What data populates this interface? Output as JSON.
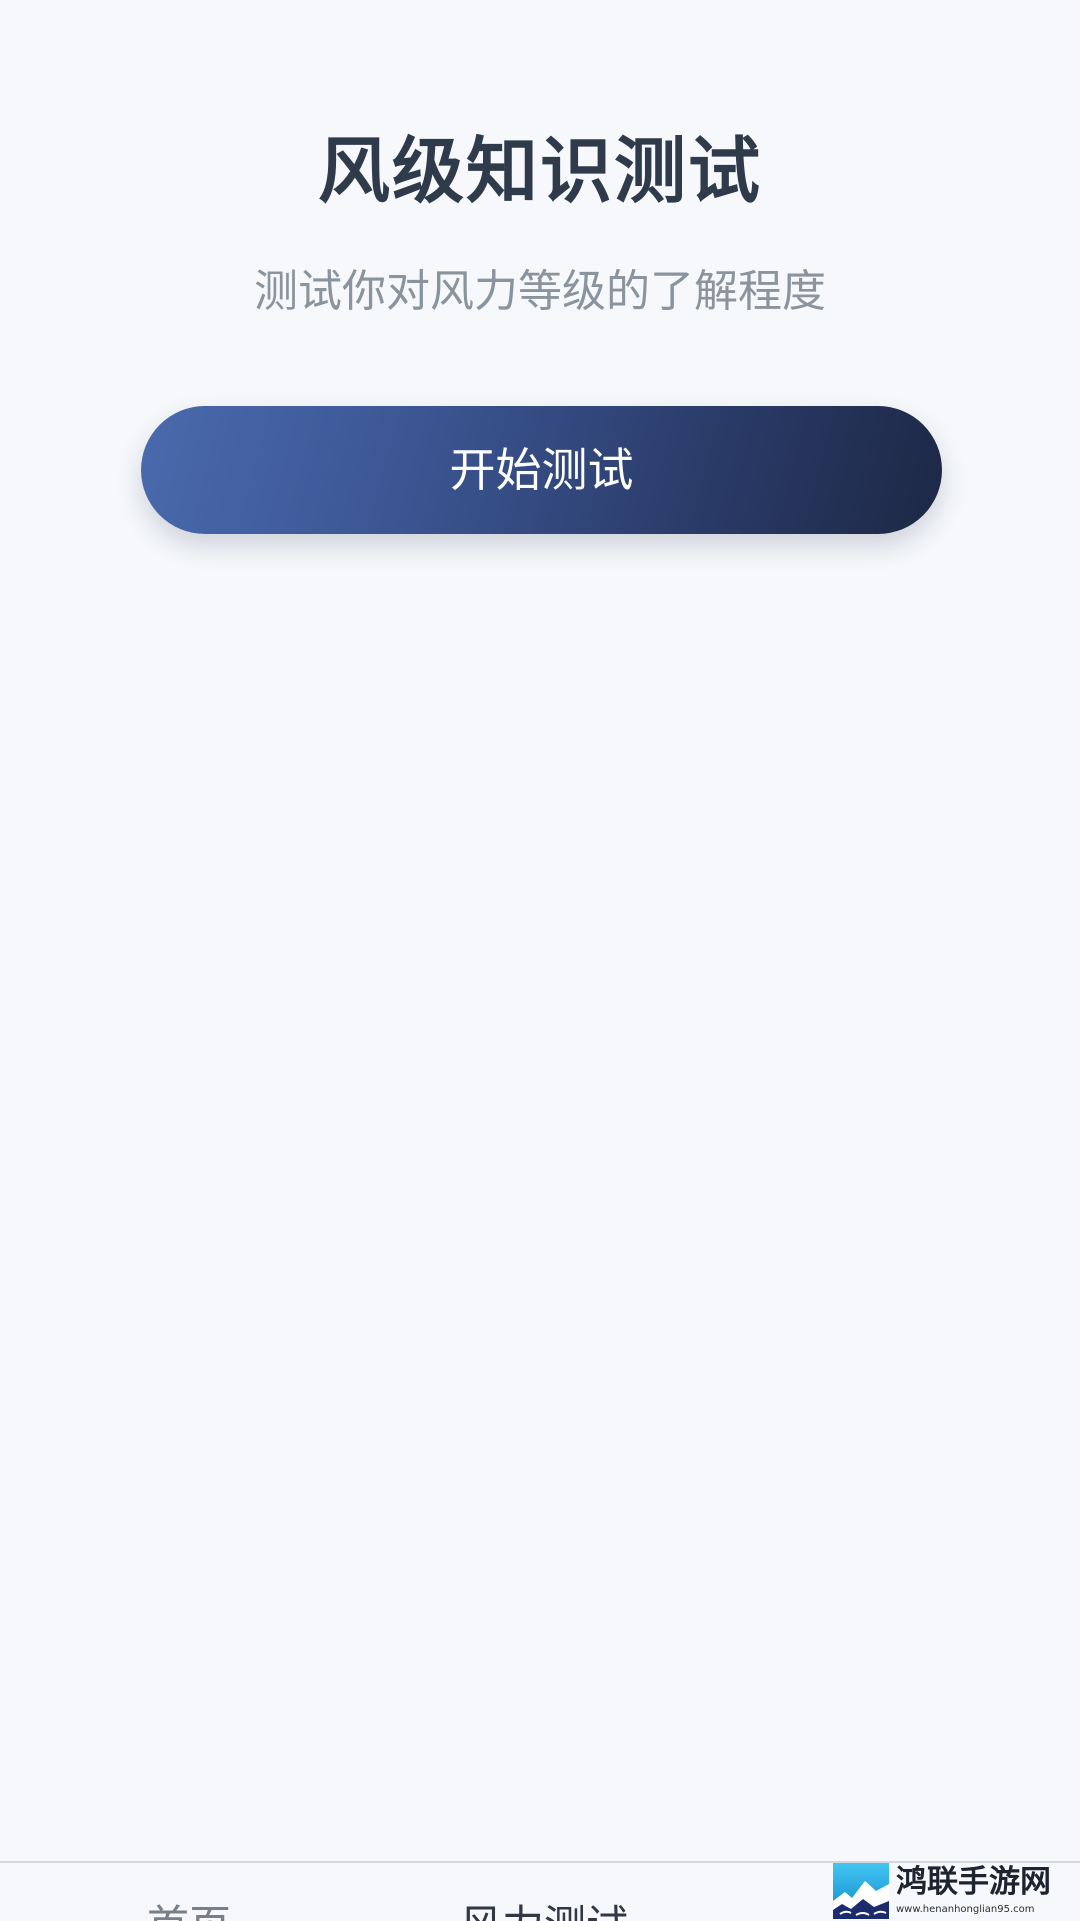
{
  "header": {
    "title": "风级知识测试",
    "subtitle": "测试你对风力等级的了解程度"
  },
  "main": {
    "start_button_label": "开始测试"
  },
  "bottom_nav": {
    "tabs": [
      {
        "label": "首页"
      },
      {
        "label": "风力测试"
      }
    ]
  },
  "watermark": {
    "name": "鸿联手游网",
    "url": "www.henanhonglian95.com"
  },
  "colors": {
    "background": "#f6f8fb",
    "title": "#2f3b4b",
    "subtitle": "#8a949e",
    "button_start": "#4a6aad",
    "button_end": "#1d2845"
  }
}
